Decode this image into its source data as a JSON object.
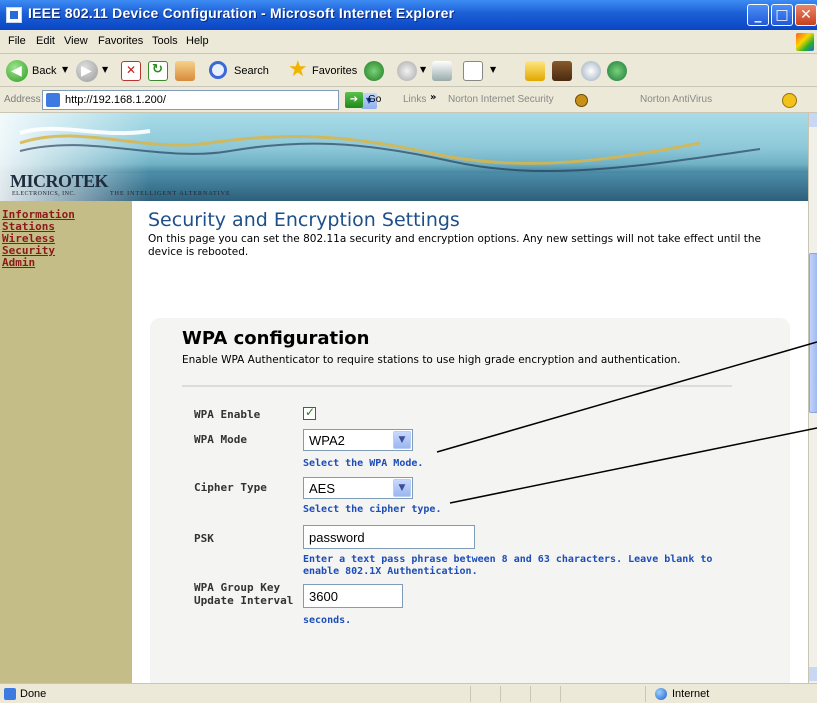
{
  "window": {
    "title": "IEEE 802.11 Device Configuration - Microsoft Internet Explorer"
  },
  "menu": [
    "File",
    "Edit",
    "View",
    "Favorites",
    "Tools",
    "Help"
  ],
  "toolbar": {
    "back_label": "Back",
    "search_label": "Search",
    "favorites_label": "Favorites"
  },
  "addressbar": {
    "label": "Address",
    "url": "http://192.168.1.200/",
    "go_label": "Go",
    "links_label": "Links",
    "links_more": "»",
    "norton_security": "Norton Internet Security",
    "norton_antivirus": "Norton AntiVirus"
  },
  "banner": {
    "logo": "MICROTEK",
    "logo_sub": "ELECTRONICS, INC.",
    "tagline": "THE INTELLIGENT ALTERNATIVE"
  },
  "nav": [
    "Information",
    "Stations",
    "Wireless",
    "Security",
    "Admin"
  ],
  "page": {
    "heading": "Security and Encryption Settings",
    "description": "On this page you can set the 802.11a security and encryption options. Any new settings will not take effect until the device is rebooted."
  },
  "wpa": {
    "title": "WPA configuration",
    "description": "Enable WPA Authenticator to require stations to use high grade encryption and authentication.",
    "enable_label": "WPA Enable",
    "enable_checked": true,
    "mode_label": "WPA Mode",
    "mode_value": "WPA2",
    "mode_hint": "Select the WPA Mode.",
    "cipher_label": "Cipher Type",
    "cipher_value": "AES",
    "cipher_hint": "Select the cipher type.",
    "psk_label": "PSK",
    "psk_value": "password",
    "psk_hint": "Enter a text pass phrase between 8 and 63 characters. Leave blank to enable 802.1X Authentication.",
    "group_key_label": "WPA Group Key Update Interval",
    "group_key_value": "3600",
    "group_key_unit": "seconds."
  },
  "status": {
    "text": "Done",
    "zone": "Internet"
  }
}
